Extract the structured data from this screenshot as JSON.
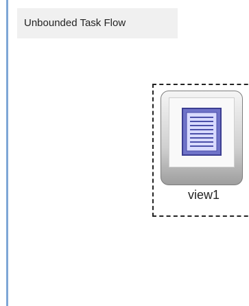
{
  "canvas": {
    "title": "Unbounded Task Flow"
  },
  "nodes": [
    {
      "label": "view1",
      "icon": "page-document-icon"
    }
  ]
}
